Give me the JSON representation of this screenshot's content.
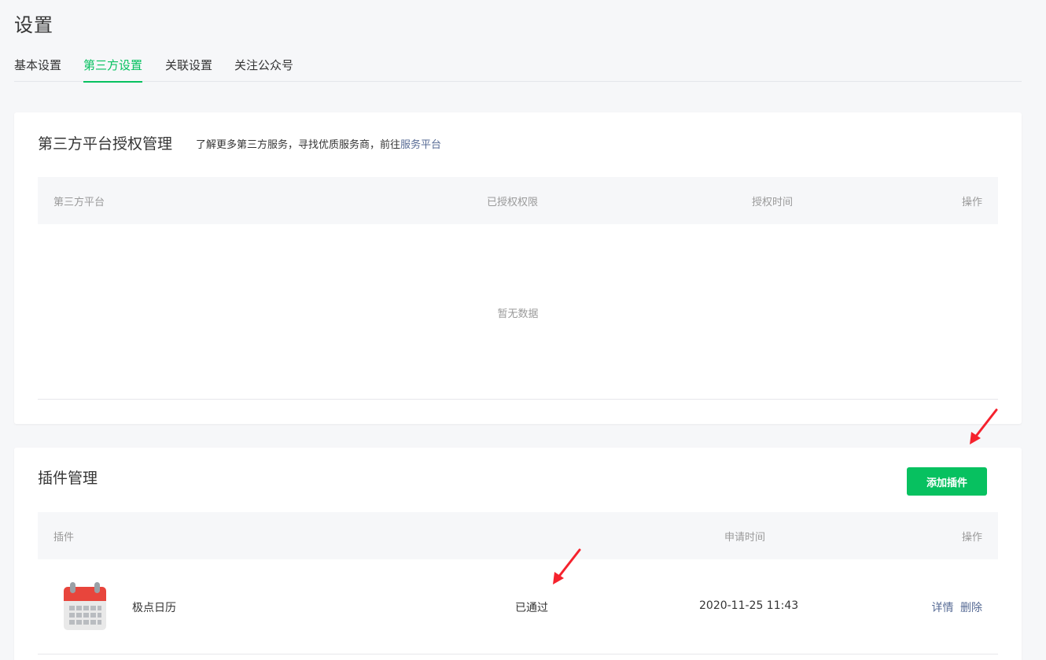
{
  "header": {
    "title": "设置"
  },
  "tabs": [
    {
      "label": "基本设置"
    },
    {
      "label": "第三方设置"
    },
    {
      "label": "关联设置"
    },
    {
      "label": "关注公众号"
    }
  ],
  "auth_section": {
    "title": "第三方平台授权管理",
    "desc_prefix": "了解更多第三方服务，寻找优质服务商，前往",
    "desc_link": "服务平台",
    "columns": [
      "第三方平台",
      "已授权权限",
      "授权时间",
      "操作"
    ],
    "empty_text": "暂无数据"
  },
  "plugin_section": {
    "title": "插件管理",
    "add_button": "添加插件",
    "columns": [
      "插件",
      "申请时间",
      "操作"
    ],
    "rows": [
      {
        "icon": "calendar-icon",
        "name": "极点日历",
        "status": "已通过",
        "time": "2020-11-25 11:43",
        "actions": [
          "详情",
          "删除"
        ]
      }
    ]
  },
  "colors": {
    "accent": "#07c160",
    "link": "#576b95",
    "annotation_arrow": "#f5222d"
  }
}
